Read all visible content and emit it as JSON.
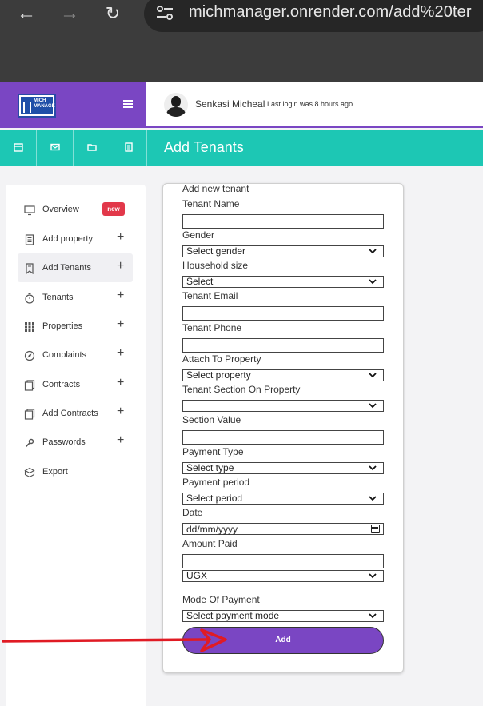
{
  "browser": {
    "url": "michmanager.onrender.com/add%20ter"
  },
  "header": {
    "user_name": "Senkasi Micheal",
    "last_login": "Last login was 8 hours ago.",
    "logo_text": "MICH MANAGE"
  },
  "page": {
    "title": "Add Tenants"
  },
  "sidebar": {
    "items": [
      {
        "label": "Overview",
        "badge": "new",
        "icon": "monitor-icon"
      },
      {
        "label": "Add property",
        "icon": "document-icon",
        "plus": "+"
      },
      {
        "label": "Add Tenants",
        "icon": "bookmark-icon",
        "plus": "+",
        "active": true
      },
      {
        "label": "Tenants",
        "icon": "timer-icon",
        "plus": "+"
      },
      {
        "label": "Properties",
        "icon": "grid-icon",
        "plus": "+"
      },
      {
        "label": "Complaints",
        "icon": "compass-icon",
        "plus": "+"
      },
      {
        "label": "Contracts",
        "icon": "copy-icon",
        "plus": "+"
      },
      {
        "label": "Add Contracts",
        "icon": "copy-icon",
        "plus": "+"
      },
      {
        "label": "Passwords",
        "icon": "key-icon",
        "plus": "+"
      },
      {
        "label": "Export",
        "icon": "box-icon"
      }
    ]
  },
  "form": {
    "heading": "Add new tenant",
    "tenant_name_label": "Tenant Name",
    "tenant_name_value": "",
    "gender_label": "Gender",
    "gender_value": "Select gender",
    "household_label": "Household size",
    "household_value": "Select",
    "email_label": "Tenant Email",
    "email_value": "",
    "phone_label": "Tenant Phone",
    "phone_value": "",
    "property_label": "Attach To Property",
    "property_value": "Select property",
    "section_label": "Tenant Section On Property",
    "section_value": "",
    "section_value_label": "Section Value",
    "section_value_input": "",
    "payment_type_label": "Payment Type",
    "payment_type_value": "Select type",
    "payment_period_label": "Payment period",
    "payment_period_value": "Select period",
    "date_label": "Date",
    "date_placeholder": "dd/mm/yyyy",
    "amount_label": "Amount Paid",
    "amount_value": "",
    "currency_value": "UGX",
    "mode_label": "Mode Of Payment",
    "mode_value": "Select payment mode",
    "submit_label": "Add"
  },
  "colors": {
    "brand_purple": "#7a46c3",
    "teal": "#1dc7b4",
    "badge_red": "#e2384a",
    "annotation_red": "#e01b24"
  }
}
